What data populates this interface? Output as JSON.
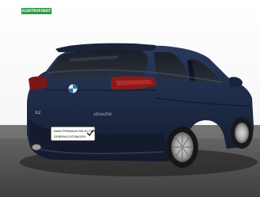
{
  "badge": {
    "label": "ELEKTROFORDT",
    "color": "#2e9a46"
  },
  "photo": {
    "subject": "Dark blue BMW X2 SUV, rear three-quarter view",
    "colors": {
      "body": "#1f2d48",
      "floor": "#4d4d4d",
      "backdrop": "#ffffff"
    }
  },
  "plate": {
    "line1": "BMW PREMIUM SELECTION",
    "line2": "GEBRAUCHTWAGEN"
  },
  "rear_badge": "X2",
  "model_badge": "sDrive20d"
}
